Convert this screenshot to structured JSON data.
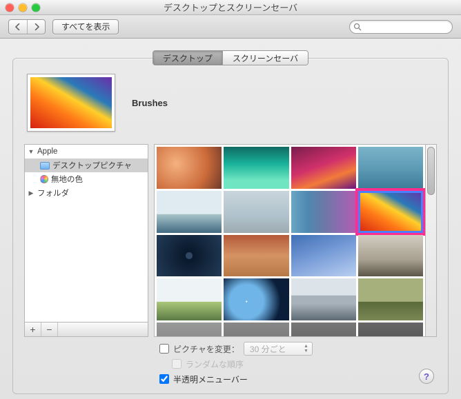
{
  "window": {
    "title": "デスクトップとスクリーンセーバ"
  },
  "traffic": {
    "close": "#ff5f57",
    "minimize": "#ffbd2e",
    "zoom": "#28c940"
  },
  "toolbar": {
    "show_all_label": "すべてを表示",
    "search_placeholder": ""
  },
  "tabs": {
    "desktop": "デスクトップ",
    "screensaver": "スクリーンセーバ",
    "active": "desktop"
  },
  "preview": {
    "name": "Brushes"
  },
  "sources": {
    "apple_label": "Apple",
    "desktop_pictures_label": "デスクトップピクチャ",
    "solid_colors_label": "無地の色",
    "folders_label": "フォルダ"
  },
  "footer_buttons": {
    "add": "+",
    "remove": "−"
  },
  "grid": {
    "selected_index": 7
  },
  "options": {
    "change_picture_label": "ピクチャを変更：",
    "interval_value": "30 分ごと",
    "random_order_label": "ランダムな順序",
    "translucent_menu_label": "半透明メニューバー",
    "change_picture_checked": false,
    "random_checked": false,
    "translucent_checked": true
  },
  "help": {
    "glyph": "?"
  }
}
